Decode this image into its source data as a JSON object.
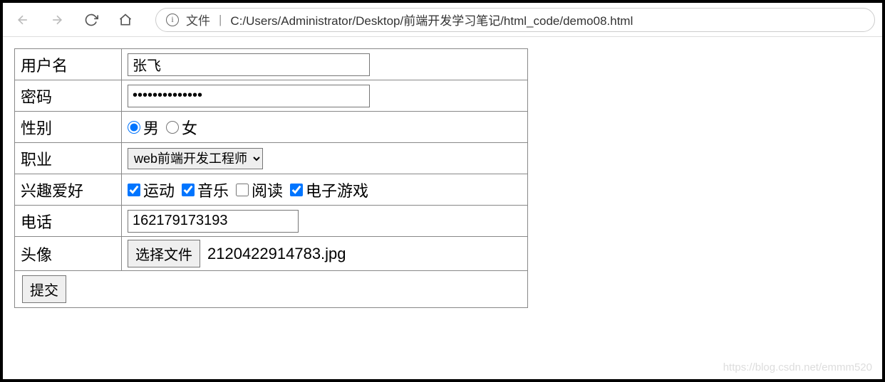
{
  "toolbar": {
    "file_label": "文件",
    "url": "C:/Users/Administrator/Desktop/前端开发学习笔记/html_code/demo08.html"
  },
  "form": {
    "labels": {
      "username": "用户名",
      "password": "密码",
      "gender": "性别",
      "occupation": "职业",
      "hobbies": "兴趣爱好",
      "phone": "电话",
      "avatar": "头像"
    },
    "username_value": "张飞",
    "password_value": "••••••••••••••",
    "gender": {
      "male": "男",
      "female": "女",
      "selected": "male"
    },
    "occupation": {
      "selected": "web前端开发工程师"
    },
    "hobbies": {
      "sport": {
        "label": "运动",
        "checked": true
      },
      "music": {
        "label": "音乐",
        "checked": true
      },
      "reading": {
        "label": "阅读",
        "checked": false
      },
      "games": {
        "label": "电子游戏",
        "checked": true
      }
    },
    "phone_value": "162179173193",
    "file": {
      "button": "选择文件",
      "filename": "2120422914783.jpg"
    },
    "submit": "提交"
  },
  "watermark": "https://blog.csdn.net/emmm520"
}
